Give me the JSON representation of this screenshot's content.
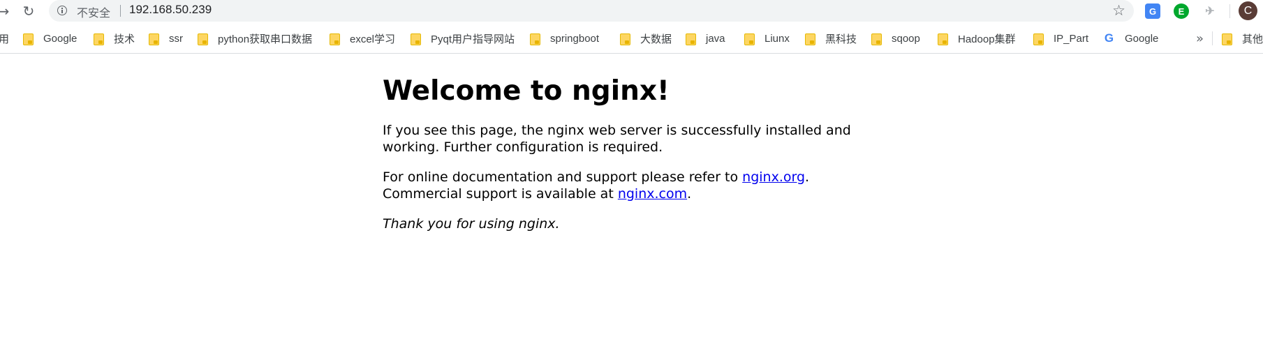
{
  "toolbar": {
    "back_icon": "arrow-left-icon",
    "reload_icon": "reload-icon",
    "security_label": "不安全",
    "url": "192.168.50.239",
    "bookmark_star_icon": "star-outline-icon",
    "extensions": [
      {
        "name": "google-translate-icon",
        "label": "G",
        "color": "#4285f4"
      },
      {
        "name": "evernote-icon",
        "label": "E",
        "color": "#00a82d"
      },
      {
        "name": "bird-extension-icon",
        "label": "✈",
        "color": "#b0b4b8"
      }
    ],
    "avatar_letter": "C",
    "avatar_color": "#5a3c36"
  },
  "bookmarks": {
    "items": [
      {
        "label": "用",
        "icon": "folder"
      },
      {
        "label": "Google",
        "icon": "folder"
      },
      {
        "label": "技术",
        "icon": "folder"
      },
      {
        "label": "ssr",
        "icon": "folder"
      },
      {
        "label": "python获取串口数据",
        "icon": "folder"
      },
      {
        "label": "excel学习",
        "icon": "folder"
      },
      {
        "label": "Pyqt用户指导网站",
        "icon": "folder"
      },
      {
        "label": "springboot",
        "icon": "folder"
      },
      {
        "label": "大数据",
        "icon": "folder"
      },
      {
        "label": "java",
        "icon": "folder"
      },
      {
        "label": "Liunx",
        "icon": "folder"
      },
      {
        "label": "黑科技",
        "icon": "folder"
      },
      {
        "label": "sqoop",
        "icon": "folder"
      },
      {
        "label": "Hadoop集群",
        "icon": "folder"
      },
      {
        "label": "IP_Part",
        "icon": "folder"
      },
      {
        "label": "Google",
        "icon": "google"
      }
    ],
    "more_label": "»",
    "other_label": "其他"
  },
  "page": {
    "heading": "Welcome to nginx!",
    "para1": "If you see this page, the nginx web server is successfully installed and working. Further configuration is required.",
    "para2_prefix": "For online documentation and support please refer to ",
    "link_org": "nginx.org",
    "para2_mid": "Commercial support is available at ",
    "link_com": "nginx.com",
    "period": ".",
    "thanks": "Thank you for using nginx."
  },
  "colors": {
    "link": "#0000ee",
    "omnibox_bg": "#f1f3f4",
    "folder": "#fdd663"
  }
}
